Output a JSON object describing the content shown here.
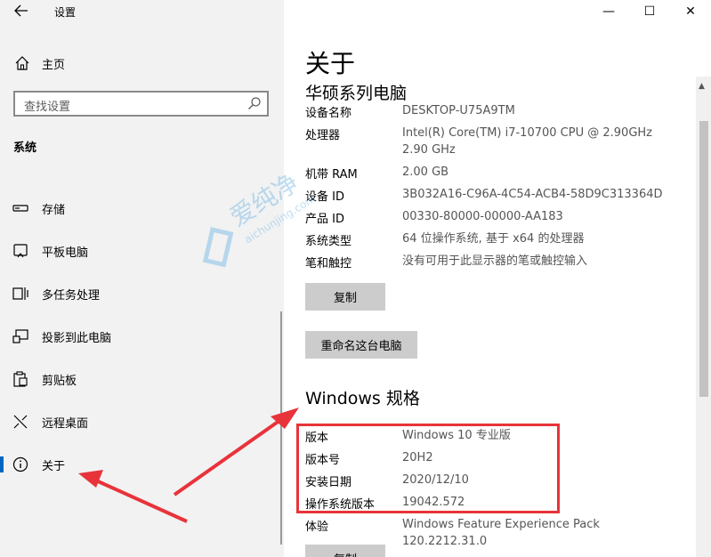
{
  "window": {
    "title": "设置",
    "controls": {
      "minimize": "—",
      "maximize": "☐",
      "close": "✕"
    }
  },
  "sidebar": {
    "home_label": "主页",
    "search_placeholder": "查找设置",
    "section_heading": "系统",
    "items": [
      {
        "label": "存储",
        "icon": "storage-icon"
      },
      {
        "label": "平板电脑",
        "icon": "tablet-icon"
      },
      {
        "label": "多任务处理",
        "icon": "multitasking-icon"
      },
      {
        "label": "投影到此电脑",
        "icon": "projecting-icon"
      },
      {
        "label": "剪贴板",
        "icon": "clipboard-icon"
      },
      {
        "label": "远程桌面",
        "icon": "remote-desktop-icon"
      },
      {
        "label": "关于",
        "icon": "info-icon",
        "active": true
      }
    ]
  },
  "main": {
    "page_title": "关于",
    "device_name_heading": "华硕系列电脑",
    "specs": [
      {
        "label": "设备名称",
        "value": "DESKTOP-U75A9TM"
      },
      {
        "label": "处理器",
        "value": "Intel(R) Core(TM) i7-10700 CPU @ 2.90GHz   2.90 GHz"
      },
      {
        "label": "机带 RAM",
        "value": "2.00 GB"
      },
      {
        "label": "设备 ID",
        "value": "3B032A16-C96A-4C54-ACB4-58D9C313364D"
      },
      {
        "label": "产品 ID",
        "value": "00330-80000-00000-AA183"
      },
      {
        "label": "系统类型",
        "value": "64 位操作系统, 基于 x64 的处理器"
      },
      {
        "label": "笔和触控",
        "value": "没有可用于此显示器的笔或触控输入"
      }
    ],
    "copy_button": "复制",
    "rename_button": "重命名这台电脑",
    "windows_heading": "Windows 规格",
    "windows_specs": [
      {
        "label": "版本",
        "value": "Windows 10 专业版"
      },
      {
        "label": "版本号",
        "value": "20H2"
      },
      {
        "label": "安装日期",
        "value": "2020/12/10"
      },
      {
        "label": "操作系统版本",
        "value": "19042.572"
      },
      {
        "label": "体验",
        "value": "Windows Feature Experience Pack 120.2212.31.0"
      }
    ],
    "copy_button_2": "复制"
  },
  "watermark": {
    "text": "爱纯净",
    "subtext": "aichunjing.com"
  },
  "colors": {
    "accent": "#0067c0",
    "annotation": "#e8333a",
    "sidebar_bg": "#f2f2f2",
    "button_bg": "#cccccc"
  }
}
